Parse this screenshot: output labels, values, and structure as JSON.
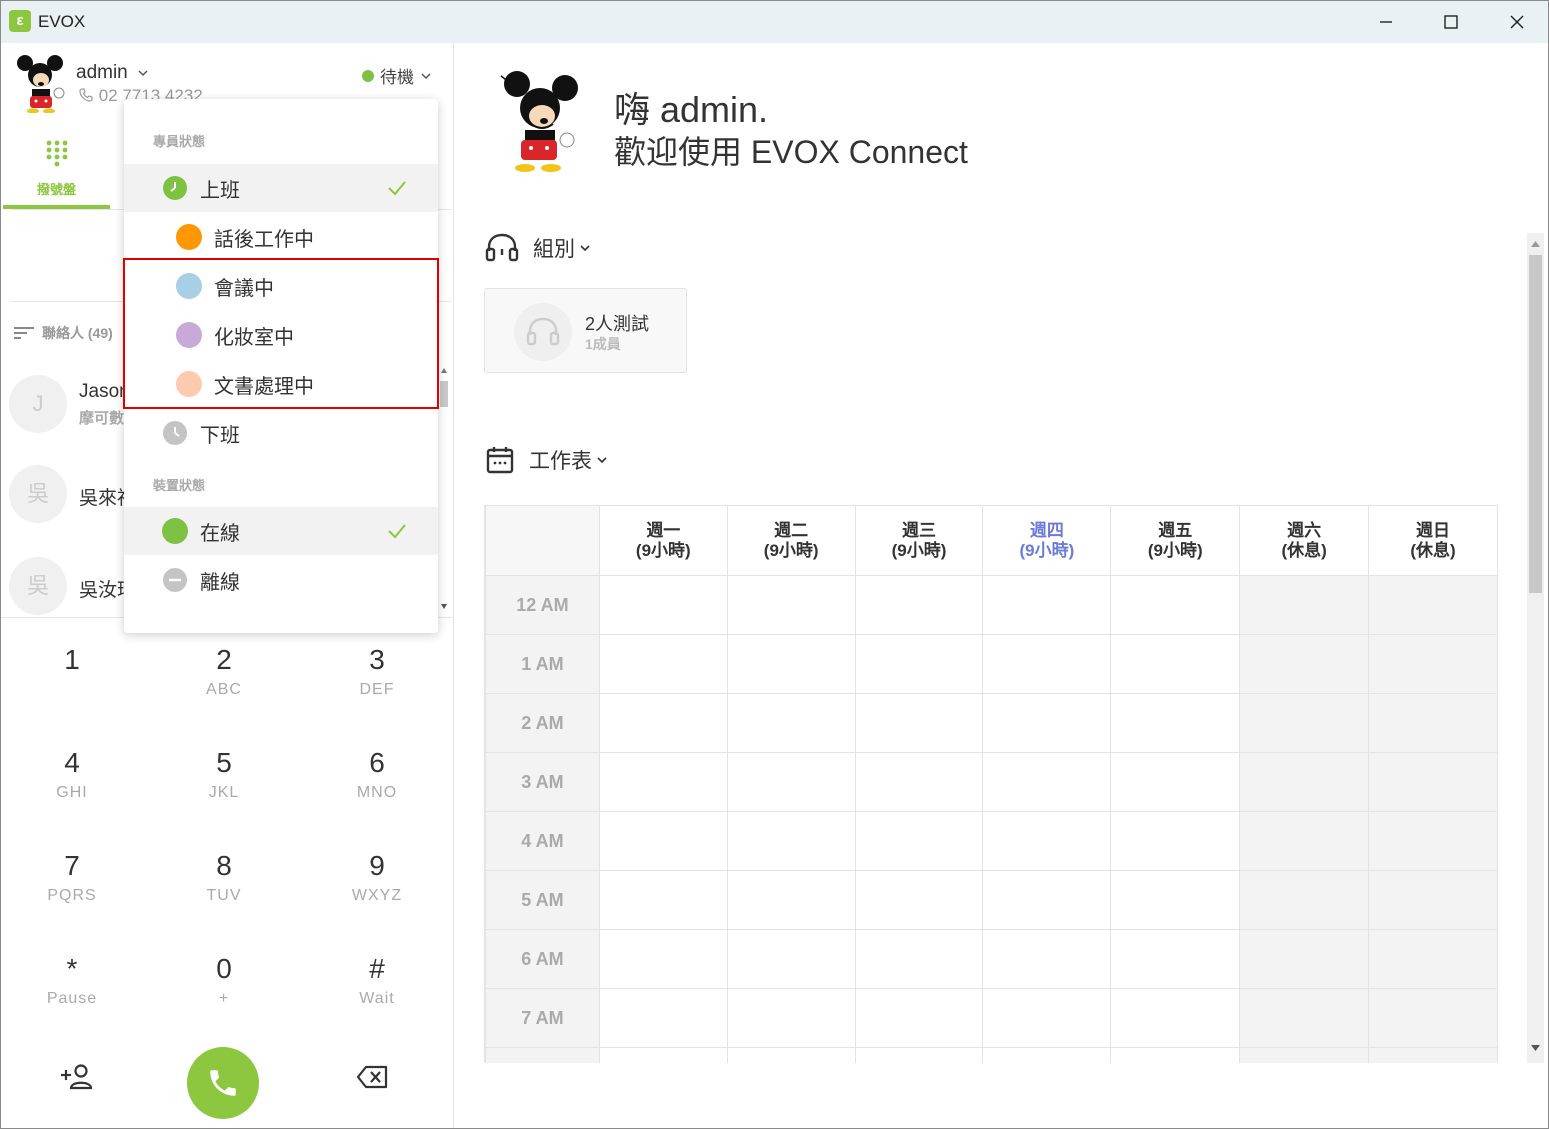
{
  "window": {
    "app_title": "EVOX",
    "logo_letter": "ε"
  },
  "user": {
    "name": "admin",
    "phone": "02 7713 4232",
    "presence": "待機",
    "presence_color": "#7dc242"
  },
  "tabs": {
    "dialpad_label": "撥號盤"
  },
  "contacts": {
    "header": "聯絡人 (49)",
    "items": [
      {
        "initial": "J",
        "name": "Jason",
        "sub": "摩可數"
      },
      {
        "initial": "吳",
        "name": "吳來福",
        "sub": ""
      },
      {
        "initial": "吳",
        "name": "吳汝玲",
        "sub": ""
      }
    ]
  },
  "dropdown": {
    "agent_section": "專員狀態",
    "device_section": "裝置狀態",
    "agent_items": [
      {
        "label": "上班",
        "color": "#7dc242",
        "selected": true
      },
      {
        "label": "話後工作中",
        "color": "#ff9800"
      },
      {
        "label": "會議中",
        "color": "#a7cfe6"
      },
      {
        "label": "化妝室中",
        "color": "#c7aad8"
      },
      {
        "label": "文書處理中",
        "color": "#ffcbb0"
      },
      {
        "label": "下班",
        "color": "#c4c4c4"
      }
    ],
    "device_items": [
      {
        "label": "在線",
        "color": "#7dc242",
        "selected": true
      },
      {
        "label": "離線",
        "color": "#c4c4c4"
      }
    ]
  },
  "keypad": [
    {
      "digit": "1",
      "letters": ""
    },
    {
      "digit": "2",
      "letters": "ABC"
    },
    {
      "digit": "3",
      "letters": "DEF"
    },
    {
      "digit": "4",
      "letters": "GHI"
    },
    {
      "digit": "5",
      "letters": "JKL"
    },
    {
      "digit": "6",
      "letters": "MNO"
    },
    {
      "digit": "7",
      "letters": "PQRS"
    },
    {
      "digit": "8",
      "letters": "TUV"
    },
    {
      "digit": "9",
      "letters": "WXYZ"
    },
    {
      "digit": "*",
      "letters": "Pause"
    },
    {
      "digit": "0",
      "letters": "+"
    },
    {
      "digit": "#",
      "letters": "Wait"
    }
  ],
  "greeting": {
    "line1": "嗨 admin.",
    "line2": "歡迎使用 EVOX Connect"
  },
  "groups": {
    "title": "組別",
    "card_name": "2人測試",
    "card_sub": "1成員"
  },
  "schedule": {
    "title": "工作表",
    "days": [
      {
        "name": "週一",
        "hours": "(9小時)",
        "today": false,
        "off": false
      },
      {
        "name": "週二",
        "hours": "(9小時)",
        "today": false,
        "off": false
      },
      {
        "name": "週三",
        "hours": "(9小時)",
        "today": false,
        "off": false
      },
      {
        "name": "週四",
        "hours": "(9小時)",
        "today": true,
        "off": false
      },
      {
        "name": "週五",
        "hours": "(9小時)",
        "today": false,
        "off": false
      },
      {
        "name": "週六",
        "hours": "(休息)",
        "today": false,
        "off": true
      },
      {
        "name": "週日",
        "hours": "(休息)",
        "today": false,
        "off": true
      }
    ],
    "times": [
      "12 AM",
      "1 AM",
      "2 AM",
      "3 AM",
      "4 AM",
      "5 AM",
      "6 AM",
      "7 AM",
      ""
    ]
  },
  "colors": {
    "brand_green": "#8dc63f",
    "today_blue": "#6c7bd8",
    "highlight_red": "#e00000"
  }
}
